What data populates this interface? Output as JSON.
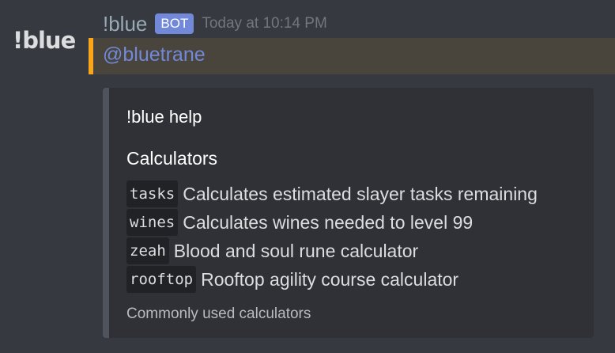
{
  "avatar": {
    "text": "!blue"
  },
  "author": {
    "name": "!blue",
    "badge": "BOT",
    "timestamp": "Today at 10:14 PM"
  },
  "message": {
    "mention": "@bluetrane",
    "highlight_color": "#faa61a"
  },
  "embed": {
    "title": "!blue help",
    "field_name": "Calculators",
    "commands": [
      {
        "code": "tasks",
        "description": "Calculates estimated slayer tasks remaining"
      },
      {
        "code": "wines",
        "description": "Calculates wines needed to level 99"
      },
      {
        "code": "zeah",
        "description": "Blood and soul rune calculator"
      },
      {
        "code": "rooftop",
        "description": "Rooftop agility course calculator"
      }
    ],
    "footer": "Commonly used calculators"
  },
  "colors": {
    "background": "#36393f",
    "embed_bg": "#2f3136",
    "bot_badge": "#7289da",
    "mention": "#7289da"
  }
}
